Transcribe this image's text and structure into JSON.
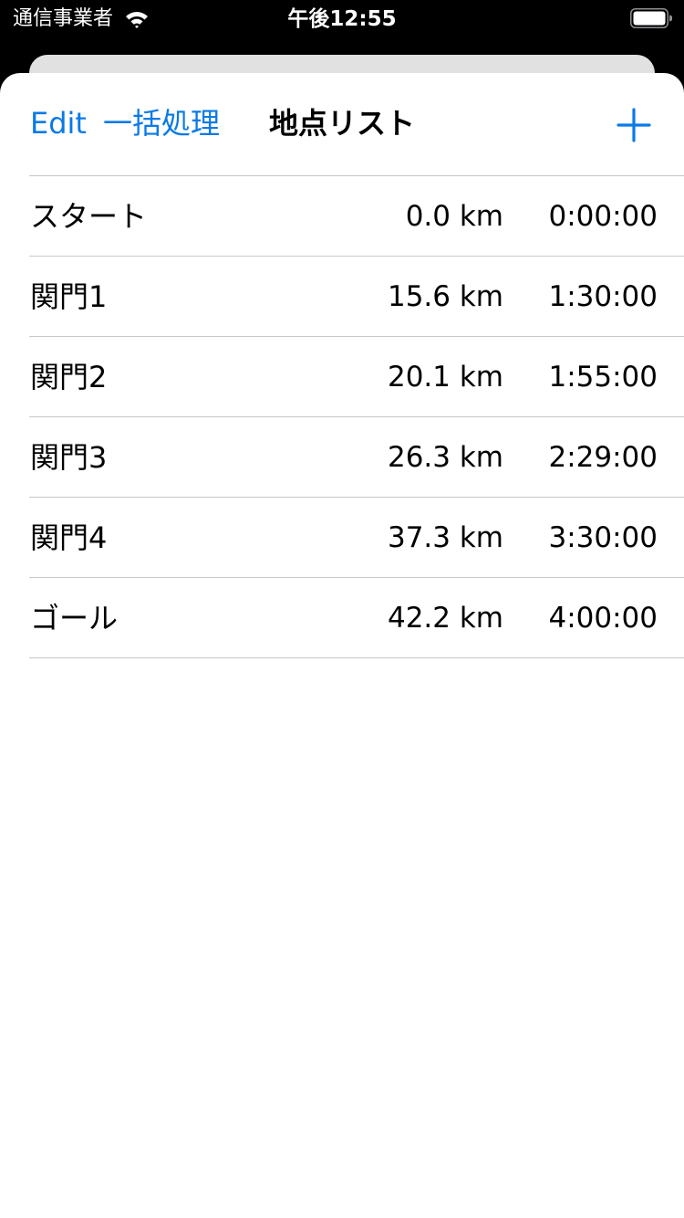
{
  "status_bar": {
    "carrier": "通信事業者",
    "time": "午後12:55",
    "wifi_icon": "wifi-icon",
    "battery_icon": "battery-full-icon"
  },
  "nav": {
    "edit_label": "Edit",
    "bulk_label": "一括処理",
    "title": "地点リスト",
    "add_icon": "plus-icon",
    "accent_color": "#0a7ae6"
  },
  "points": [
    {
      "name": "スタート",
      "distance": "0.0 km",
      "time": "0:00:00"
    },
    {
      "name": "関門1",
      "distance": "15.6 km",
      "time": "1:30:00"
    },
    {
      "name": "関門2",
      "distance": "20.1 km",
      "time": "1:55:00"
    },
    {
      "name": "関門3",
      "distance": "26.3 km",
      "time": "2:29:00"
    },
    {
      "name": "関門4",
      "distance": "37.3 km",
      "time": "3:30:00"
    },
    {
      "name": "ゴール",
      "distance": "42.2 km",
      "time": "4:00:00"
    }
  ]
}
